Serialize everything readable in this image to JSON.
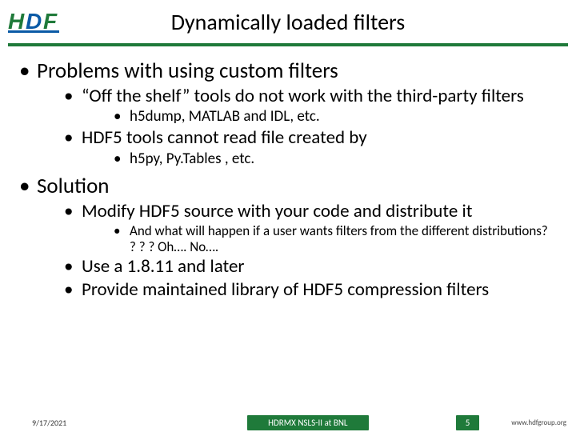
{
  "header": {
    "title": "Dynamically loaded filters"
  },
  "body": {
    "s1": "Problems with using custom filters",
    "s1a": "“Off the shelf” tools do not work with the third-party filters",
    "s1a1": "h5dump, MATLAB and IDL, etc.",
    "s1b": "HDF5 tools cannot read file created by",
    "s1b1": "h5py, Py.Tables , etc.",
    "s2": "Solution",
    "s2a": "Modify HDF5 source with your code and distribute it",
    "s2a1": "And what will happen if a user wants filters from the different distributions? ? ? ? Oh…. No….",
    "s2b": "Use a 1.8.11 and later",
    "s2c": "Provide maintained library of HDF5 compression filters"
  },
  "footer": {
    "date": "9/17/2021",
    "center": "HDRMX NSLS-II at BNL",
    "page": "5",
    "url": "www.hdfgroup.org"
  }
}
